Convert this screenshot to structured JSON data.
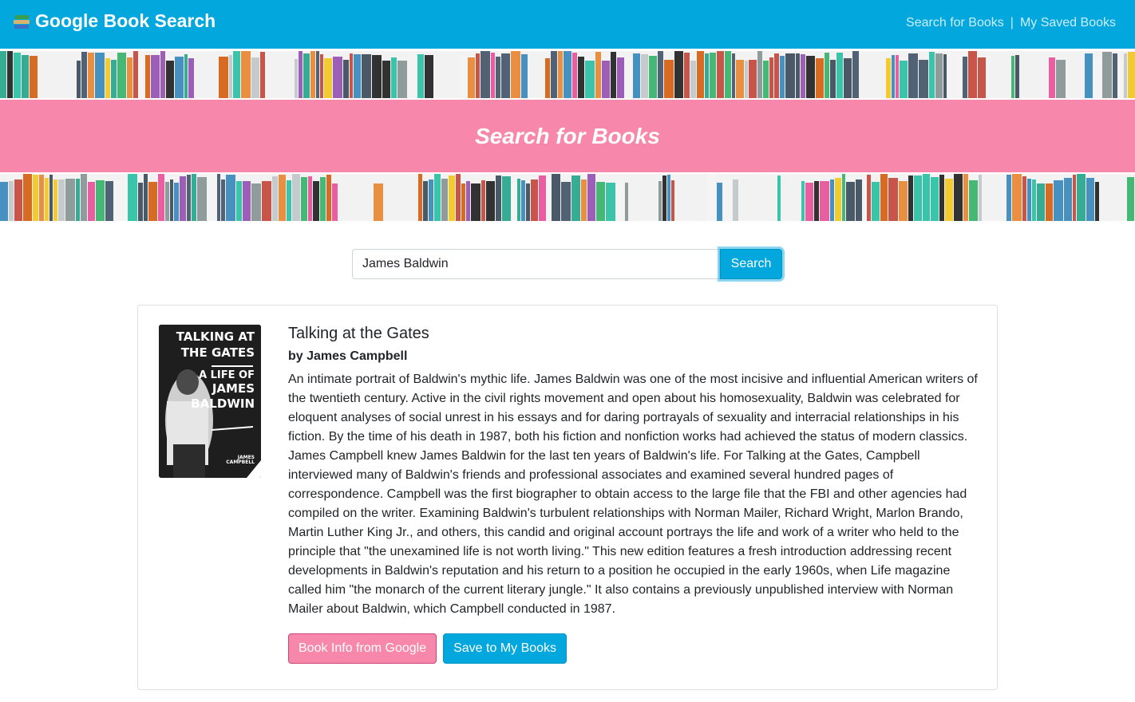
{
  "navbar": {
    "brand_icon": "books-icon",
    "brand": "Google Book Search",
    "links": [
      "Search for Books",
      "My Saved Books"
    ],
    "separator": "|"
  },
  "hero": {
    "title": "Search for Books",
    "band_color": "#f788ab"
  },
  "search": {
    "value": "James Baldwin",
    "button_label": "Search"
  },
  "results": [
    {
      "title": "Talking at the Gates",
      "author": "by James Campbell",
      "cover": {
        "line1": "TALKING AT",
        "line2": "THE GATES",
        "line3": "A LIFE OF",
        "line4": "JAMES",
        "line5": "BALDWIN",
        "author": "JAMES CAMPBELL"
      },
      "description": "An intimate portrait of Baldwin's mythic life. James Baldwin was one of the most incisive and influential American writers of the twentieth century. Active in the civil rights movement and open about his homosexuality, Baldwin was celebrated for eloquent analyses of social unrest in his essays and for daring portrayals of sexuality and interracial relationships in his fiction. By the time of his death in 1987, both his fiction and nonfiction works had achieved the status of modern classics. James Campbell knew James Baldwin for the last ten years of Baldwin's life. For Talking at the Gates, Campbell interviewed many of Baldwin's friends and professional associates and examined several hundred pages of correspondence. Campbell was the first biographer to obtain access to the large file that the FBI and other agencies had compiled on the writer. Examining Baldwin's turbulent relationships with Norman Mailer, Richard Wright, Marlon Brando, Martin Luther King Jr., and others, this candid and original account portrays the life and work of a writer who held to the principle that \"the unexamined life is not worth living.\" This new edition features a fresh introduction addressing recent developments in Baldwin's reputation and his return to a position he occupied in the early 1960s, when Life magazine called him \"the monarch of the current literary jungle.\" It also contains a previously unpublished interview with Norman Mailer about Baldwin, which Campbell conducted in 1987.",
      "info_button": "Book Info from Google",
      "save_button": "Save to My Books"
    }
  ],
  "colors": {
    "primary": "#01a7dd",
    "accent": "#f788ab"
  }
}
